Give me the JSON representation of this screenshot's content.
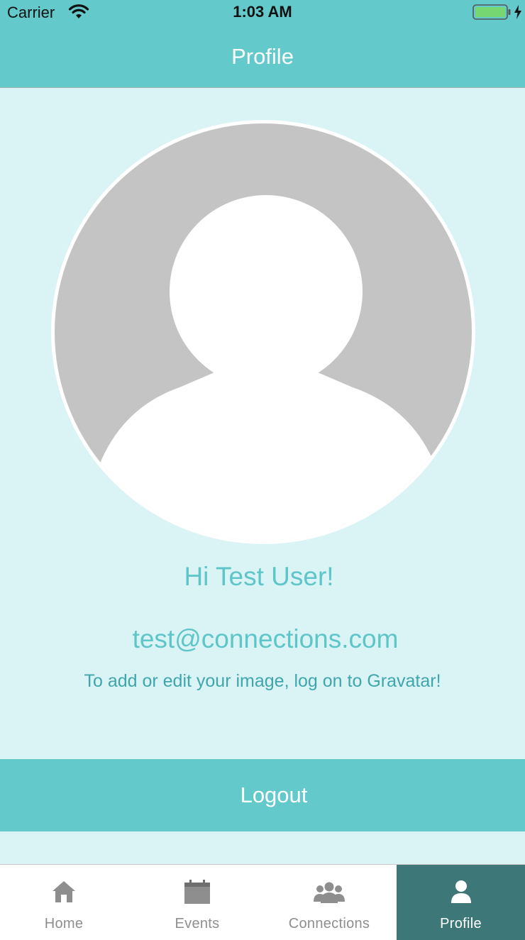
{
  "status_bar": {
    "carrier": "Carrier",
    "time": "1:03 AM",
    "battery_color": "#76d672"
  },
  "nav": {
    "title": "Profile"
  },
  "profile": {
    "greeting": "Hi Test User!",
    "email": "test@connections.com",
    "hint": "To add or edit your image, log on to Gravatar!"
  },
  "logout_label": "Logout",
  "tabs": [
    {
      "label": "Home",
      "icon": "home-icon",
      "active": false
    },
    {
      "label": "Events",
      "icon": "calendar-icon",
      "active": false
    },
    {
      "label": "Connections",
      "icon": "group-icon",
      "active": false
    },
    {
      "label": "Profile",
      "icon": "person-icon",
      "active": true
    }
  ],
  "colors": {
    "accent": "#63c9cb",
    "background": "#daf3f5",
    "tab_active": "#3d7777"
  }
}
